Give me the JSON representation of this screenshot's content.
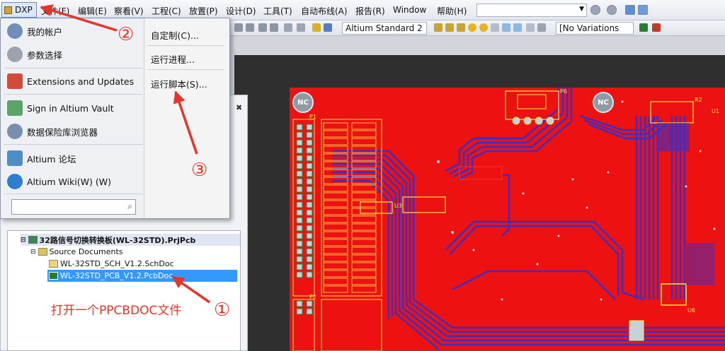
{
  "menubar": {
    "dxp": "DXP",
    "items": [
      "文件(F)",
      "编辑(E)",
      "察看(V)",
      "工程(C)",
      "放置(P)",
      "设计(D)",
      "工具(T)",
      "自动布线(A)",
      "报告(R)",
      "Window",
      "帮助(H)"
    ]
  },
  "toolbar": {
    "standard_combo": "Altium Standard 2",
    "variations_combo": "[No Variations"
  },
  "dxp_menu": {
    "left": [
      {
        "label": "我的帐户",
        "icon": "user-icon"
      },
      {
        "label": "参数选择",
        "icon": "gear-icon"
      },
      {
        "label": "Extensions and Updates",
        "icon": "extensions-icon"
      },
      {
        "label": "Sign in Altium Vault",
        "icon": "vault-icon"
      },
      {
        "label": "数据保险库浏览器",
        "icon": "database-icon"
      },
      {
        "label": "Altium 论坛",
        "icon": "forum-icon"
      },
      {
        "label": "Altium Wiki(W) (W)",
        "icon": "help-icon"
      }
    ],
    "search_value": "",
    "right": [
      "自定制(C)...",
      "运行进程...",
      "运行脚本(S)..."
    ]
  },
  "project_tree": {
    "project": "32路信号切换转换板(WL-32STD).PrjPcb",
    "folder": "Source Documents",
    "files": [
      "WL-32STD_SCH_V1.2.SchDoc",
      "WL-32STD_PCB_V1.2.PcbDoc"
    ]
  },
  "annotations": {
    "step1_text": "打开一个PPCBDOC文件",
    "step1_num": "①",
    "step2_num": "②",
    "step3_num": "③"
  },
  "pcb": {
    "nc_label": "NC",
    "ref_labels": [
      "P1",
      "P2",
      "P6",
      "U1",
      "U3",
      "U6",
      "R2"
    ]
  },
  "colors": {
    "copper_top": "#ee1111",
    "copper_bottom": "#3a2ec4",
    "silkscreen": "#f2e94a",
    "annotation": "#e2362a",
    "selection": "#3399ff"
  }
}
